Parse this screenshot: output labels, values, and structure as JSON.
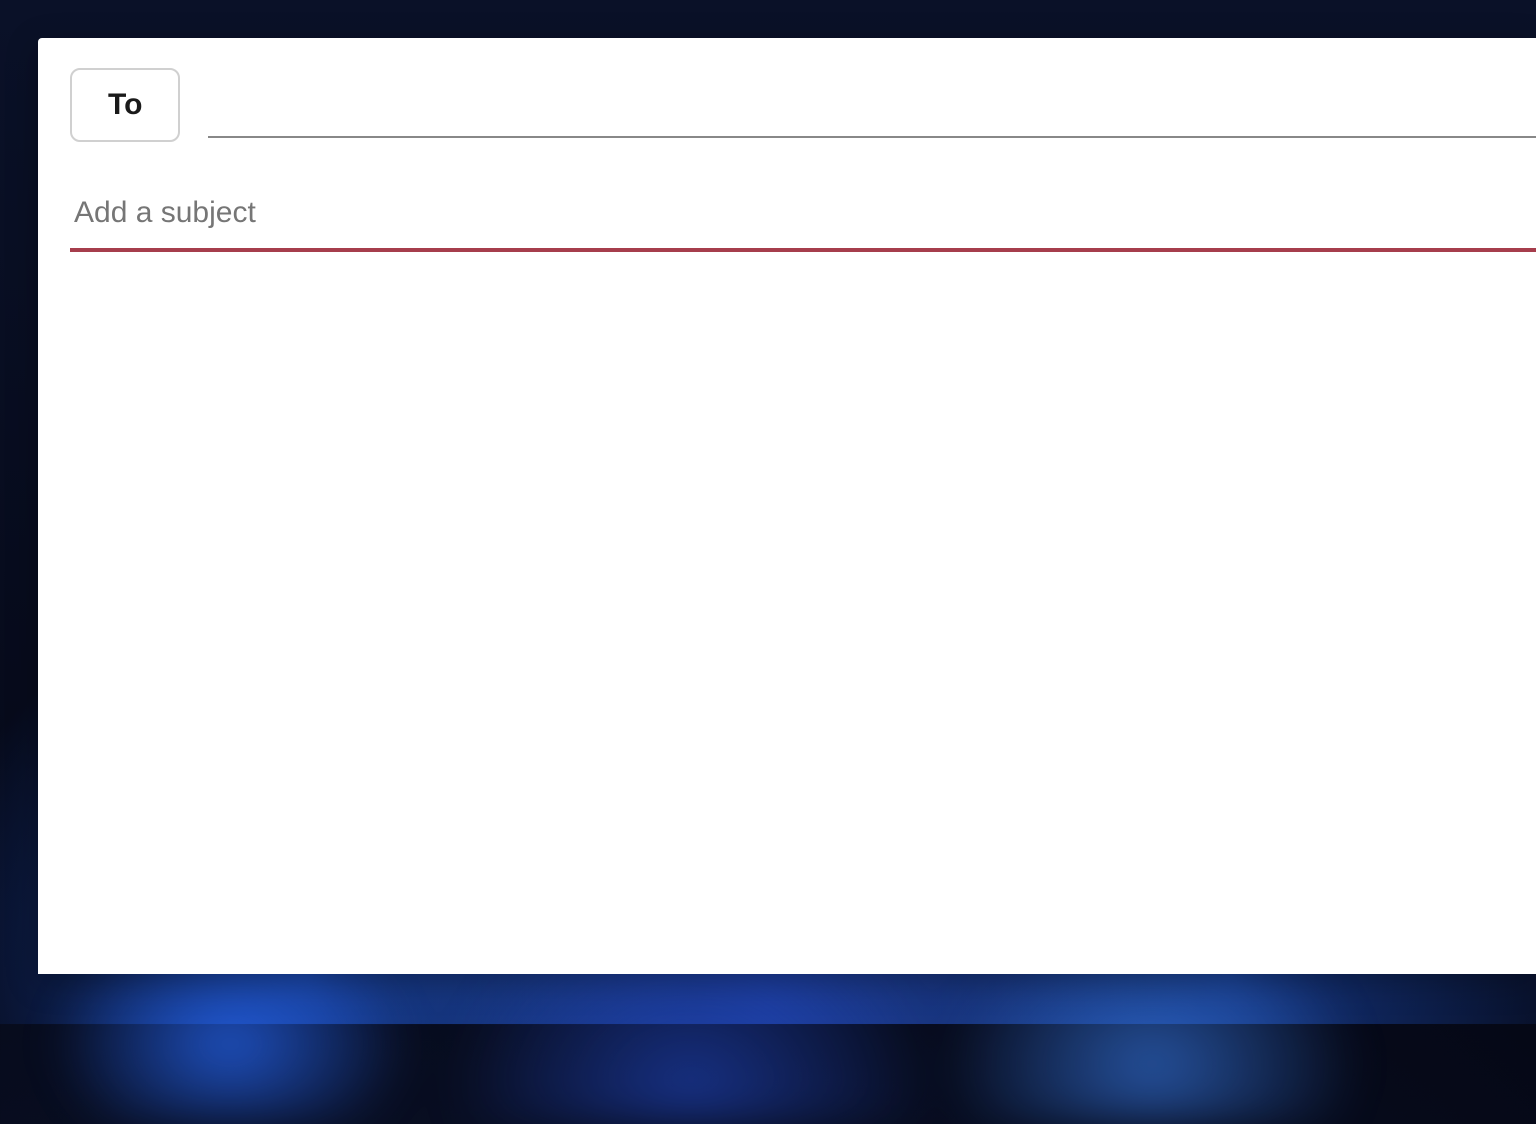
{
  "compose": {
    "to_button_label": "To",
    "to_value": "",
    "subject_placeholder": "Add a subject",
    "subject_value": "",
    "body_value": ""
  },
  "colors": {
    "accent_underline": "#a63d4c",
    "field_underline": "#888888",
    "button_border": "#d0d0d0"
  }
}
